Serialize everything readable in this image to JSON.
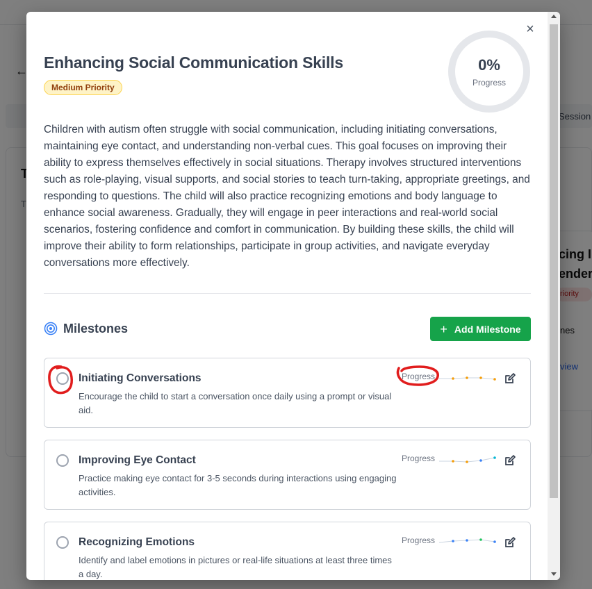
{
  "background": {
    "partial_text_1": "Т",
    "partial_text_2": "Т",
    "partial_sessions": "Session",
    "partial_card_title_1": "cing I",
    "partial_card_title_2": "ender",
    "partial_badge": "riority",
    "partial_milestones": "nes",
    "partial_link": "view"
  },
  "modal": {
    "close_icon": "close-icon",
    "title": "Enhancing Social Communication Skills",
    "priority": "Medium Priority",
    "progress_value": "0%",
    "progress_label": "Progress",
    "progress_fraction": 0,
    "description": "Children with autism often struggle with social communication, including initiating conversations, maintaining eye contact, and understanding non-verbal cues. This goal focuses on improving their ability to express themselves effectively in social situations. Therapy involves structured interventions such as role-playing, visual supports, and social stories to teach turn-taking, appropriate greetings, and responding to questions. The child will also practice recognizing emotions and body language to enhance social awareness. Gradually, they will engage in peer interactions and real-world social scenarios, fostering confidence and comfort in communication. By building these skills, the child will improve their ability to form relationships, participate in group activities, and navigate everyday conversations more effectively."
  },
  "milestones": {
    "heading": "Milestones",
    "add_button": "Add Milestone",
    "items": [
      {
        "title": "Initiating Conversations",
        "description": "Encourage the child to start a conversation once daily using a prompt or visual aid.",
        "progress_label": "Progress"
      },
      {
        "title": "Improving Eye Contact",
        "description": "Practice making eye contact for 3-5 seconds during interactions using engaging activities.",
        "progress_label": "Progress"
      },
      {
        "title": "Recognizing Emotions",
        "description": "Identify and label emotions in pictures or real-life situations at least three times a day.",
        "progress_label": "Progress"
      }
    ]
  },
  "colors": {
    "accent_green": "#16a34a",
    "priority_bg": "#fef3c7",
    "annotation_red": "#e11d1d"
  }
}
